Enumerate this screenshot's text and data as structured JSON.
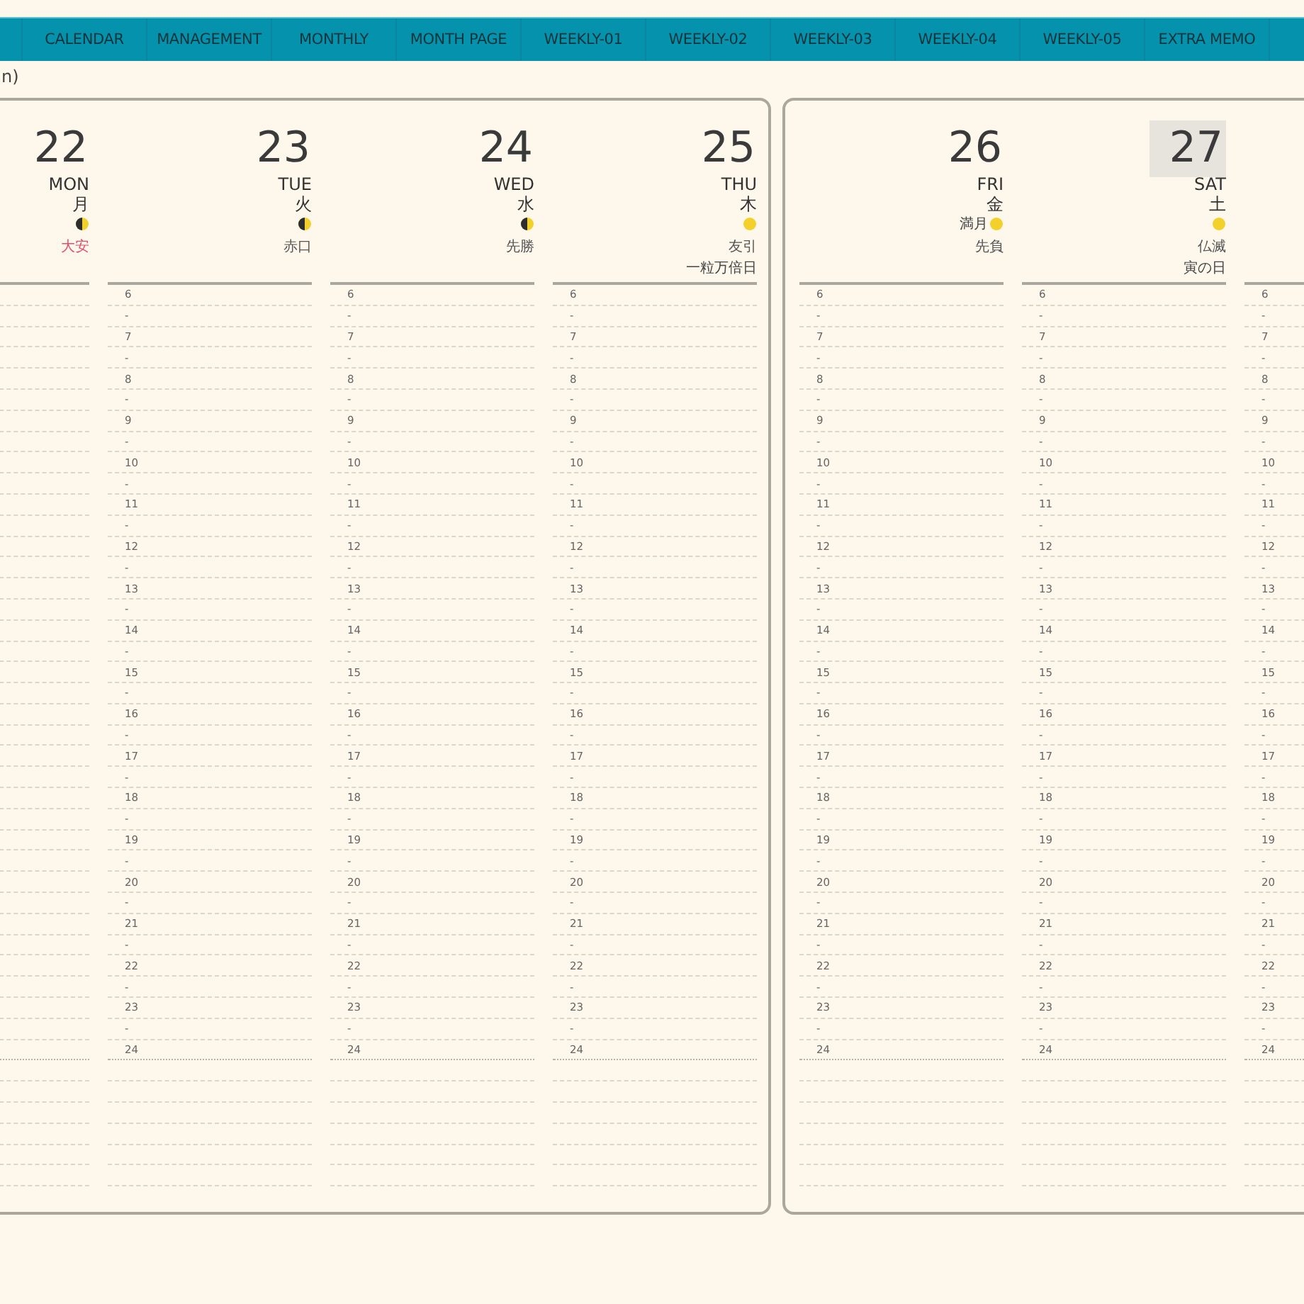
{
  "tabs": [
    {
      "label": "CALENDAR"
    },
    {
      "label": "MANAGEMENT"
    },
    {
      "label": "MONTHLY"
    },
    {
      "label": "MONTH PAGE"
    },
    {
      "label": "WEEKLY-01"
    },
    {
      "label": "WEEKLY-02"
    },
    {
      "label": "WEEKLY-03"
    },
    {
      "label": "WEEKLY-04"
    },
    {
      "label": "WEEKLY-05"
    },
    {
      "label": "EXTRA MEMO"
    }
  ],
  "subtitle": "n)",
  "pages": [
    {
      "columns": [
        {
          "day": "22",
          "weekday": "MON",
          "kanji": "月",
          "moon": {
            "kind": "quarter"
          },
          "rokuyo": "大安",
          "color": "#e0506a",
          "highlighted": false
        },
        {
          "day": "23",
          "weekday": "TUE",
          "kanji": "火",
          "moon": {
            "kind": "quarter"
          },
          "rokuyo": "赤口",
          "color": "#555555",
          "highlighted": false,
          "hours": [
            "6",
            "-",
            "7",
            "-",
            "8",
            "-",
            "9",
            "-",
            "10",
            "-",
            "11",
            "-",
            "12",
            "-",
            "13",
            "-",
            "14",
            "-",
            "15",
            "-",
            "16",
            "-",
            "17",
            "-",
            "18",
            "-",
            "19",
            "-",
            "20",
            "-",
            "21",
            "-",
            "22",
            "-",
            "23",
            "-",
            "24"
          ]
        },
        {
          "day": "24",
          "weekday": "WED",
          "kanji": "水",
          "moon": {
            "kind": "quarter"
          },
          "rokuyo": "先勝",
          "color": "#555555",
          "highlighted": false,
          "hours": [
            "6",
            "-",
            "7",
            "-",
            "8",
            "-",
            "9",
            "-",
            "10",
            "-",
            "11",
            "-",
            "12",
            "-",
            "13",
            "-",
            "14",
            "-",
            "15",
            "-",
            "16",
            "-",
            "17",
            "-",
            "18",
            "-",
            "19",
            "-",
            "20",
            "-",
            "21",
            "-",
            "22",
            "-",
            "23",
            "-",
            "24"
          ]
        },
        {
          "day": "25",
          "weekday": "THU",
          "kanji": "木",
          "moon": {
            "kind": "full"
          },
          "rokuyo": "友引",
          "note": "一粒万倍日",
          "color": "#555555",
          "highlighted": false,
          "hours": [
            "6",
            "-",
            "7",
            "-",
            "8",
            "-",
            "9",
            "-",
            "10",
            "-",
            "11",
            "-",
            "12",
            "-",
            "13",
            "-",
            "14",
            "-",
            "15",
            "-",
            "16",
            "-",
            "17",
            "-",
            "18",
            "-",
            "19",
            "-",
            "20",
            "-",
            "21",
            "-",
            "22",
            "-",
            "23",
            "-",
            "24"
          ]
        }
      ]
    },
    {
      "columns": [
        {
          "day": "26",
          "weekday": "FRI",
          "kanji": "金",
          "moon": {
            "kind": "full",
            "label": "満月"
          },
          "rokuyo": "先負",
          "color": "#555555",
          "highlighted": false,
          "hours": [
            "6",
            "-",
            "7",
            "-",
            "8",
            "-",
            "9",
            "-",
            "10",
            "-",
            "11",
            "-",
            "12",
            "-",
            "13",
            "-",
            "14",
            "-",
            "15",
            "-",
            "16",
            "-",
            "17",
            "-",
            "18",
            "-",
            "19",
            "-",
            "20",
            "-",
            "21",
            "-",
            "22",
            "-",
            "23",
            "-",
            "24"
          ]
        },
        {
          "day": "27",
          "weekday": "SAT",
          "kanji": "土",
          "moon": {
            "kind": "full"
          },
          "rokuyo": "仏滅",
          "note": "寅の日",
          "color": "#555555",
          "highlighted": true,
          "hours": [
            "6",
            "-",
            "7",
            "-",
            "8",
            "-",
            "9",
            "-",
            "10",
            "-",
            "11",
            "-",
            "12",
            "-",
            "13",
            "-",
            "14",
            "-",
            "15",
            "-",
            "16",
            "-",
            "17",
            "-",
            "18",
            "-",
            "19",
            "-",
            "20",
            "-",
            "21",
            "-",
            "22",
            "-",
            "23",
            "-",
            "24"
          ]
        },
        {
          "hours": [
            "6",
            "-",
            "7",
            "-",
            "8",
            "-",
            "9",
            "-",
            "10",
            "-",
            "11",
            "-",
            "12",
            "-",
            "13",
            "-",
            "14",
            "-",
            "15",
            "-",
            "16",
            "-",
            "17",
            "-",
            "18",
            "-",
            "19",
            "-",
            "20",
            "-",
            "21",
            "-",
            "22",
            "-",
            "23",
            "-",
            "24"
          ]
        }
      ]
    }
  ]
}
